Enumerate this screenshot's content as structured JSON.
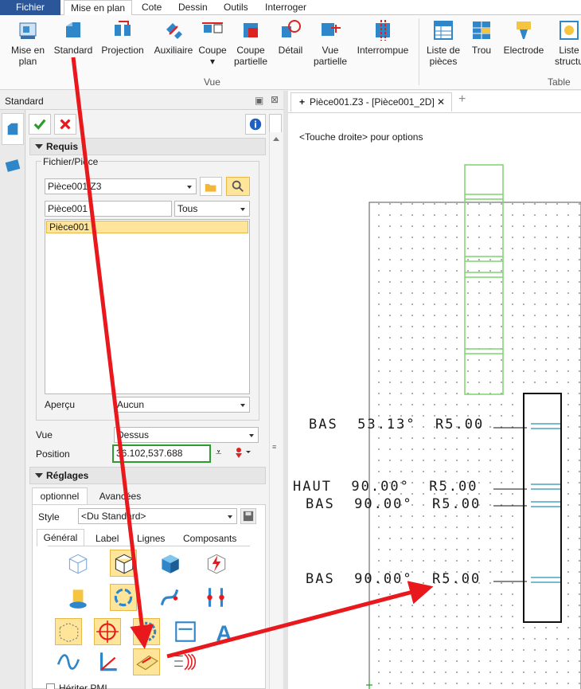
{
  "menu": {
    "items": [
      "Fichier",
      "Mise en plan",
      "Cote",
      "Dessin",
      "Outils",
      "Interroger"
    ]
  },
  "ribbon": {
    "buttons": [
      {
        "label1": "Mise en",
        "label2": "plan",
        "icon": "layout-sheet-icon"
      },
      {
        "label1": "Standard",
        "label2": "",
        "icon": "standard-view-icon"
      },
      {
        "label1": "Projection",
        "label2": "",
        "icon": "projection-icon"
      },
      {
        "label1": "Auxiliaire",
        "label2": "",
        "icon": "auxiliary-view-icon"
      },
      {
        "label1": "Coupe",
        "label2": "▾",
        "icon": "section-icon"
      },
      {
        "label1": "Coupe",
        "label2": "partielle",
        "icon": "partial-section-icon"
      },
      {
        "label1": "Détail",
        "label2": "",
        "icon": "detail-icon"
      },
      {
        "label1": "Vue",
        "label2": "partielle",
        "icon": "partial-view-icon"
      },
      {
        "label1": "Interrompue",
        "label2": "",
        "icon": "broken-view-icon"
      },
      {
        "label1": "Liste de",
        "label2": "pièces",
        "icon": "bom-icon"
      },
      {
        "label1": "Trou",
        "label2": "",
        "icon": "hole-table-icon"
      },
      {
        "label1": "Electrode",
        "label2": "",
        "icon": "electrode-icon"
      },
      {
        "label1": "Liste",
        "label2": "structu",
        "icon": "structure-list-icon"
      }
    ],
    "groups": {
      "vue": "Vue",
      "table": "Table"
    }
  },
  "left_panel": {
    "title": "Standard",
    "requis": "Requis",
    "fichier_piece": "Fichier/Pièce",
    "file_value": "Pièce001.Z3",
    "part_value": "Pièce001",
    "filter_value": "Tous",
    "list_items": [
      "Pièce001"
    ],
    "apercu_label": "Aperçu",
    "apercu_value": "Aucun",
    "vue_label": "Vue",
    "vue_value": "Dessus",
    "position_label": "Position",
    "position_value": "36.102,537.688",
    "reglages": "Réglages",
    "tabs": [
      "optionnel",
      "Avancées"
    ],
    "style_label": "Style",
    "style_value": "<Du Standard>",
    "subtabs": [
      "Général",
      "Label",
      "Lignes",
      "Composants"
    ],
    "heriter": "Hériter PMI"
  },
  "document": {
    "tab_title": "Pièce001.Z3 - [Pièce001_2D]",
    "hint": "<Touche droite> pour options",
    "annotations": [
      "BAS  53.13°  R5.00",
      "HAUT  90.00°  R5.00",
      "BAS  90.00°  R5.00",
      "BAS  90.00°  R5.00"
    ]
  },
  "colors": {
    "accent": "#2b579a",
    "highlight": "#ffe59a",
    "arrow": "#e8181c",
    "green": "#2e9b2e"
  }
}
